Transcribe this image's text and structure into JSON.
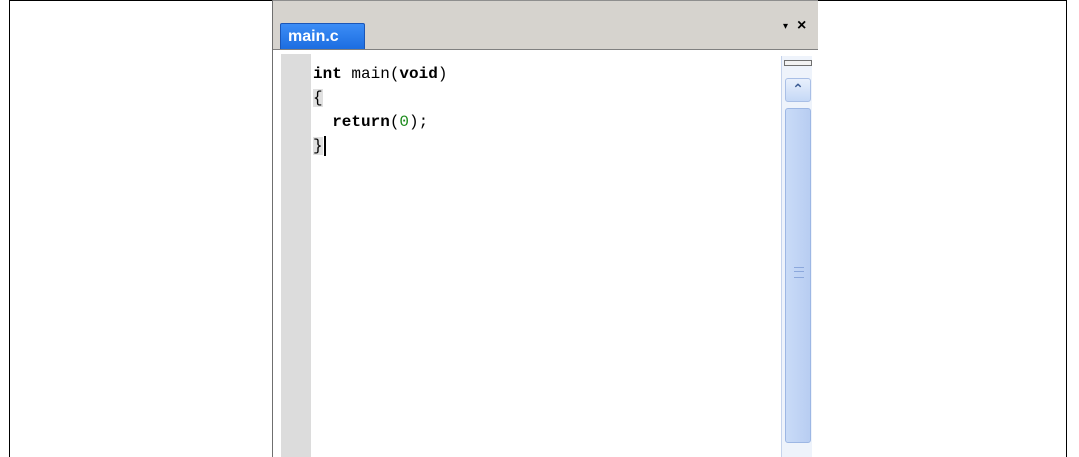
{
  "tab": {
    "label": "main.c"
  },
  "window_controls": {
    "dropdown_glyph": "▾",
    "close_glyph": "×"
  },
  "editor": {
    "lines": [
      {
        "keyword_1": "int",
        "text": " main(",
        "keyword_2": "void",
        "text_2": ")"
      },
      {
        "brace": "{"
      },
      {
        "indent": "  ",
        "keyword": "return",
        "paren_open": "(",
        "number": "0",
        "tail": ");"
      },
      {
        "brace": "}"
      }
    ]
  },
  "scrollbar": {
    "up_icon": "chevron-up-icon",
    "up_glyph": "⌃"
  },
  "colors": {
    "tab_active": "#2a7ae8",
    "number_literal": "#1a8a1a",
    "scrollbar": "#c9dbf7"
  }
}
